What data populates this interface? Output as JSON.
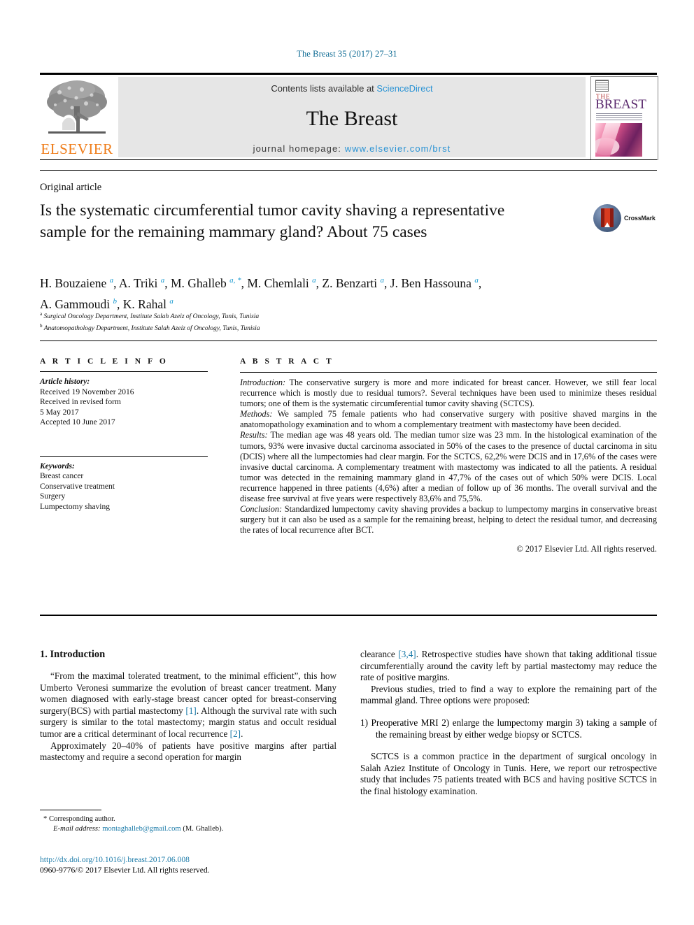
{
  "running_head": "The Breast 35 (2017) 27–31",
  "banner": {
    "contents_prefix": "Contents lists available at ",
    "sciencedirect": "ScienceDirect",
    "journal_title": "The Breast",
    "homepage_prefix": "journal homepage: ",
    "homepage_url": "www.elsevier.com/brst",
    "publisher_name": "ELSEVIER",
    "cover_the": "THE",
    "cover_breast": "BREAST",
    "link_color": "#2a93d4",
    "banner_bg": "#e6e6e6"
  },
  "article": {
    "type": "Original article",
    "title": "Is the systematic circumferential tumor cavity shaving a representative sample for the remaining mammary gland? About 75 cases",
    "crossmark_label": "CrossMark"
  },
  "authors": {
    "line1_html": "H. Bouzaiene <span class=\"aff-marker\">a</span>, A. Triki <span class=\"aff-marker\">a</span>, M. Ghalleb <span class=\"aff-marker\">a, *</span>, M. Chemlali <span class=\"aff-marker\">a</span>, Z. Benzarti <span class=\"aff-marker\">a</span>, J. Ben Hassouna <span class=\"aff-marker\">a</span>,",
    "line2_html": "A. Gammoudi <span class=\"aff-marker\">b</span>, K. Rahal <span class=\"aff-marker\">a</span>",
    "affiliation_a": "Surgical Oncology Department, Institute Salah Azeiz of Oncology, Tunis, Tunisia",
    "affiliation_b": "Anatomopathology Department, Institute Salah Azeiz of Oncology, Tunis, Tunisia"
  },
  "article_info": {
    "heading": "A R T I C L E   I N F O",
    "history_label": "Article history:",
    "received": "Received 19 November 2016",
    "revised_label": "Received in revised form",
    "revised_date": "5 May 2017",
    "accepted": "Accepted 10 June 2017",
    "keywords_label": "Keywords:",
    "keywords": [
      "Breast cancer",
      "Conservative treatment",
      "Surgery",
      "Lumpectomy shaving"
    ]
  },
  "abstract": {
    "heading": "A B S T R A C T",
    "introduction_label": "Introduction:",
    "introduction_text": " The conservative surgery is more and more indicated for breast cancer. However, we still fear local recurrence which is mostly due to residual tumors?. Several techniques have been used to minimize theses residual tumors; one of them is the systematic circumferential tumor cavity shaving (SCTCS).",
    "methods_label": "Methods:",
    "methods_text": " We sampled 75 female patients who had conservative surgery with positive shaved margins in the anatomopathology examination and to whom a complementary treatment with mastectomy have been decided.",
    "results_label": "Results:",
    "results_text": " The median age was 48 years old. The median tumor size was 23 mm. In the histological examination of the tumors, 93% were invasive ductal carcinoma associated in 50% of the cases to the presence of ductal carcinoma in situ (DCIS) where all the lumpectomies had clear margin. For the SCTCS, 62,2% were DCIS and in 17,6% of the cases were invasive ductal carcinoma. A complementary treatment with mastectomy was indicated to all the patients. A residual tumor was detected in the remaining mammary gland in 47,7% of the cases out of which 50% were DCIS. Local recurrence happened in three patients (4,6%) after a median of follow up of 36 months. The overall survival and the disease free survival at five years were respectively 83,6% and 75,5%.",
    "conclusion_label": "Conclusion:",
    "conclusion_text": " Standardized lumpectomy cavity shaving provides a backup to lumpectomy margins in conservative breast surgery but it can also be used as a sample for the remaining breast, helping to detect the residual tumor, and decreasing the rates of local recurrence after BCT.",
    "copyright": "© 2017 Elsevier Ltd. All rights reserved."
  },
  "body": {
    "section_number_title": "1.  Introduction",
    "left_p1_part1": "“From the maximal tolerated treatment, to the minimal efficient”, this how Umberto Veronesi summarize the evolution of breast cancer treatment. Many women diagnosed with early-stage breast cancer opted for breast-conserving surgery(BCS) with partial mastectomy ",
    "left_p1_ref": "[1]",
    "left_p1_part2": ". Although the survival rate with such surgery is similar to the total mastectomy; margin status and occult residual tumor are a critical determinant of local recurrence ",
    "left_p1_ref2": "[2]",
    "left_p1_part3": ".",
    "left_p2": "Approximately 20–40% of patients have positive margins after partial mastectomy and require a second operation for margin",
    "right_p1_part1": "clearance ",
    "right_p1_ref": "[3,4]",
    "right_p1_part2": ". Retrospective studies have shown that taking additional tissue circumferentially around the cavity left by partial mastectomy may reduce the rate of positive margins.",
    "right_p2": "Previous studies, tried to find a way to explore the remaining part of the mammal gland. Three options were proposed:",
    "right_list_item": "1) Preoperative MRI 2) enlarge the lumpectomy margin 3) taking a sample of the remaining breast by either wedge biopsy or SCTCS.",
    "right_p3": "SCTCS is a common practice in the department of surgical oncology in Salah Aziez Institute of Oncology in Tunis. Here, we report our retrospective study that includes 75 patients treated with BCS and having positive SCTCS in the final histology examination."
  },
  "footer": {
    "corresponding_marker": "*",
    "corresponding_label": "Corresponding author.",
    "email_label": "E-mail address:",
    "email": "montaghalleb@gmail.com",
    "email_suffix": "(M. Ghalleb).",
    "doi": "http://dx.doi.org/10.1016/j.breast.2017.06.008",
    "issn_line": "0960-9776/© 2017 Elsevier Ltd. All rights reserved."
  }
}
